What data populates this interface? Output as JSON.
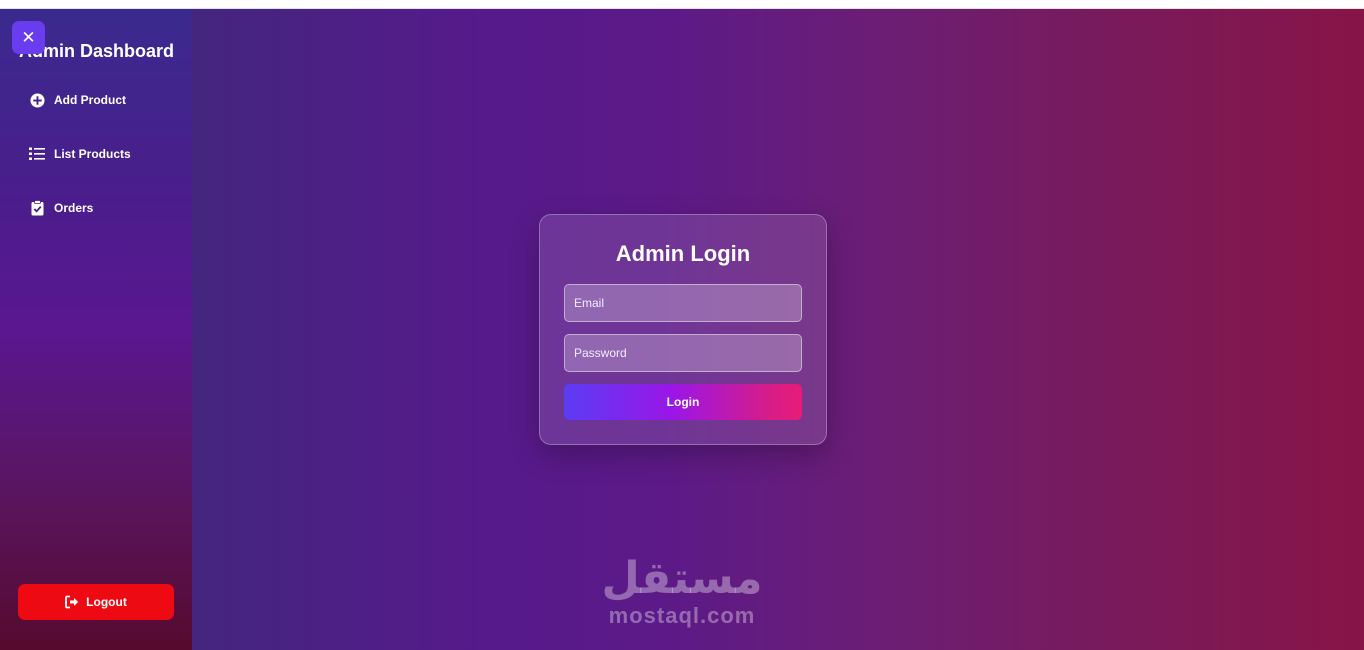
{
  "sidebar": {
    "title": "Admin Dashboard",
    "close_icon": "close-icon",
    "items": [
      {
        "label": "Add Product",
        "icon": "plus-circle-icon"
      },
      {
        "label": "List Products",
        "icon": "list-icon"
      },
      {
        "label": "Orders",
        "icon": "clipboard-check-icon"
      }
    ],
    "logout_label": "Logout",
    "logout_icon": "logout-icon"
  },
  "login": {
    "title": "Admin Login",
    "email_placeholder": "Email",
    "password_placeholder": "Password",
    "submit_label": "Login"
  },
  "watermark": {
    "arabic": "مستقل",
    "latin": "mostaql.com"
  },
  "colors": {
    "accent": "#6a3cf0",
    "logout": "#ee0a12",
    "login_gradient_start": "#5b3cf3",
    "login_gradient_end": "#e81c78"
  }
}
